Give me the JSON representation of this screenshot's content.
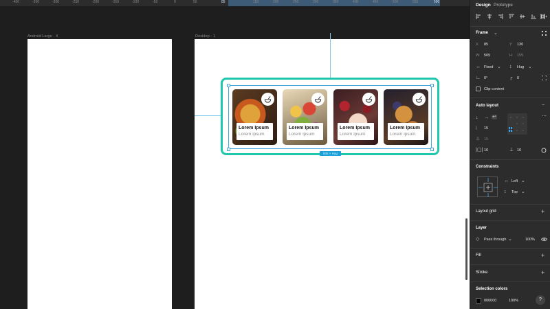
{
  "ruler": {
    "numbers": [
      "-400",
      "-350",
      "-300",
      "-250",
      "-200",
      "-150",
      "-100",
      "-50",
      "0",
      "50",
      "100",
      "150",
      "200",
      "250",
      "300",
      "350",
      "400",
      "450",
      "500",
      "550"
    ],
    "selection_start": "85",
    "selection_end": "590"
  },
  "canvas": {
    "frames": [
      {
        "label": "Android Large - 4"
      },
      {
        "label": "Desktop - 1"
      }
    ],
    "size_tag": "505 × Hug",
    "cards": [
      {
        "title": "Lorem Ipsum",
        "subtitle": "Lorem ipsum",
        "image": "pizza"
      },
      {
        "title": "Lorem Ipsum",
        "subtitle": "Lorem ipsum",
        "image": "salad-bowl"
      },
      {
        "title": "Lorem Ipsum",
        "subtitle": "Lorem ipsum",
        "image": "cake"
      },
      {
        "title": "Lorem Ipsum",
        "subtitle": "Lorem ipsum",
        "image": "pancakes"
      }
    ],
    "accent_color": "#1fc7ad",
    "selection_color": "#49a8e0"
  },
  "panel": {
    "tabs": {
      "design": "Design",
      "prototype": "Prototype"
    },
    "frame": {
      "title": "Frame",
      "x_label": "X",
      "x_value": "85",
      "y_label": "Y",
      "y_value": "130",
      "w_label": "W",
      "w_value": "505",
      "h_label": "H",
      "h_value": "155",
      "width_mode": "Fixed",
      "height_mode": "Hug",
      "rotation": "0°",
      "radius": "0",
      "clip_content": "Clip content"
    },
    "auto_layout": {
      "title": "Auto layout",
      "spacing": "15",
      "spacing_secondary": "15",
      "padding_h": "10",
      "padding_v": "10"
    },
    "constraints": {
      "title": "Constraints",
      "horizontal": "Left",
      "vertical": "Top"
    },
    "layout_grid": {
      "title": "Layout grid"
    },
    "layer": {
      "title": "Layer",
      "blend_mode": "Pass through",
      "opacity": "100%"
    },
    "fill": {
      "title": "Fill"
    },
    "stroke": {
      "title": "Stroke"
    },
    "selection_colors": {
      "title": "Selection colors",
      "hex": "000000",
      "opacity": "100%"
    },
    "help": "?"
  }
}
